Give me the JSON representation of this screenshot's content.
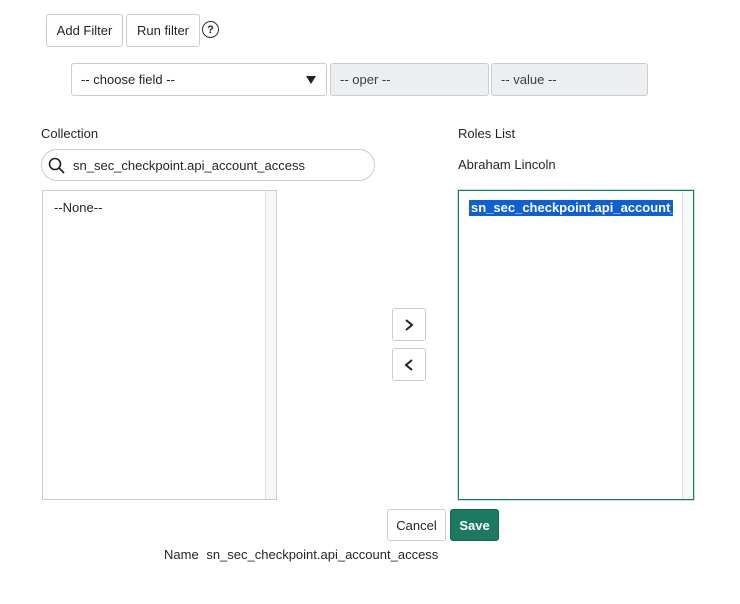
{
  "toolbar": {
    "add_filter_label": "Add Filter",
    "run_filter_label": "Run filter",
    "help_glyph": "?"
  },
  "filter": {
    "field_value": "-- choose field --",
    "oper_value": "-- oper --",
    "value_value": "-- value --"
  },
  "collection": {
    "label": "Collection",
    "search_value": "sn_sec_checkpoint.api_account_access",
    "items": [
      "--None--"
    ]
  },
  "roles": {
    "label": "Roles List",
    "user": "Abraham Lincoln",
    "items": [
      "sn_sec_checkpoint.api_account_access"
    ]
  },
  "transfer": {
    "add_glyph": "›",
    "remove_glyph": "‹"
  },
  "footer": {
    "cancel_label": "Cancel",
    "save_label": "Save",
    "name_label": "Name",
    "name_value": "sn_sec_checkpoint.api_account_access"
  },
  "colors": {
    "save_bg": "#1c7a62",
    "selection_bg": "#0f5fd6",
    "focus_border": "#1c7a62"
  }
}
